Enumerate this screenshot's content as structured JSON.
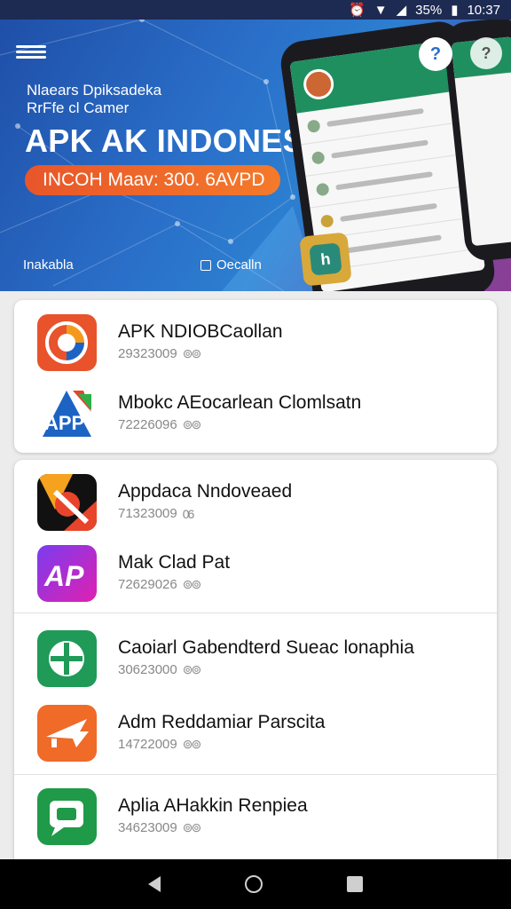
{
  "status_bar": {
    "battery_percent": "35%",
    "time": "10:37",
    "icons": [
      "alarm-icon",
      "wifi-icon",
      "signal-icon",
      "battery-icon"
    ]
  },
  "banner": {
    "subtitle_line1": "Nlaears Dpiksadeka",
    "subtitle_line2": "RrFfe cl Camer",
    "headline": "APK AK INDONESA",
    "promo": "INCOH Maav: 300. 6AVPD",
    "bottom_left": "Inakabla",
    "bottom_right": "Oecalln",
    "help_label": "?",
    "help2_label": "?"
  },
  "apps": [
    {
      "name": "APK NDIOBCaollan",
      "meta": "29323009",
      "icon": "camera-lens-icon",
      "color": "#e8532b"
    },
    {
      "name": "Mbokc AEocarlean Clomlsatn",
      "meta": "72226096",
      "icon": "apk-logo-icon",
      "color": "#1d63c4"
    },
    {
      "name": "Appdaca Nndoveaed",
      "meta": "71323009",
      "icon": "brush-icon",
      "color": "#111111"
    },
    {
      "name": "Mak Clad Pat",
      "meta": "72629026",
      "icon": "ap-logo-icon",
      "color": "#c020d0"
    },
    {
      "name": "Caoiarl Gabendterd Sueac lonaphia",
      "meta": "30623000",
      "icon": "switch-icon",
      "color": "#1f9a57"
    },
    {
      "name": "Adm Reddamiar Parscita",
      "meta": "14722009",
      "icon": "airplane-icon",
      "color": "#f06a28"
    },
    {
      "name": "Aplia AHakkin Renpiea",
      "meta": "34623009",
      "icon": "chat-icon",
      "color": "#1f9a48"
    }
  ],
  "app_meta_suffix": [
    "⊚⊚",
    "⊚⊚",
    "06",
    "⊚⊚",
    "⊚⊚",
    "⊚⊚",
    "⊚⊚"
  ]
}
